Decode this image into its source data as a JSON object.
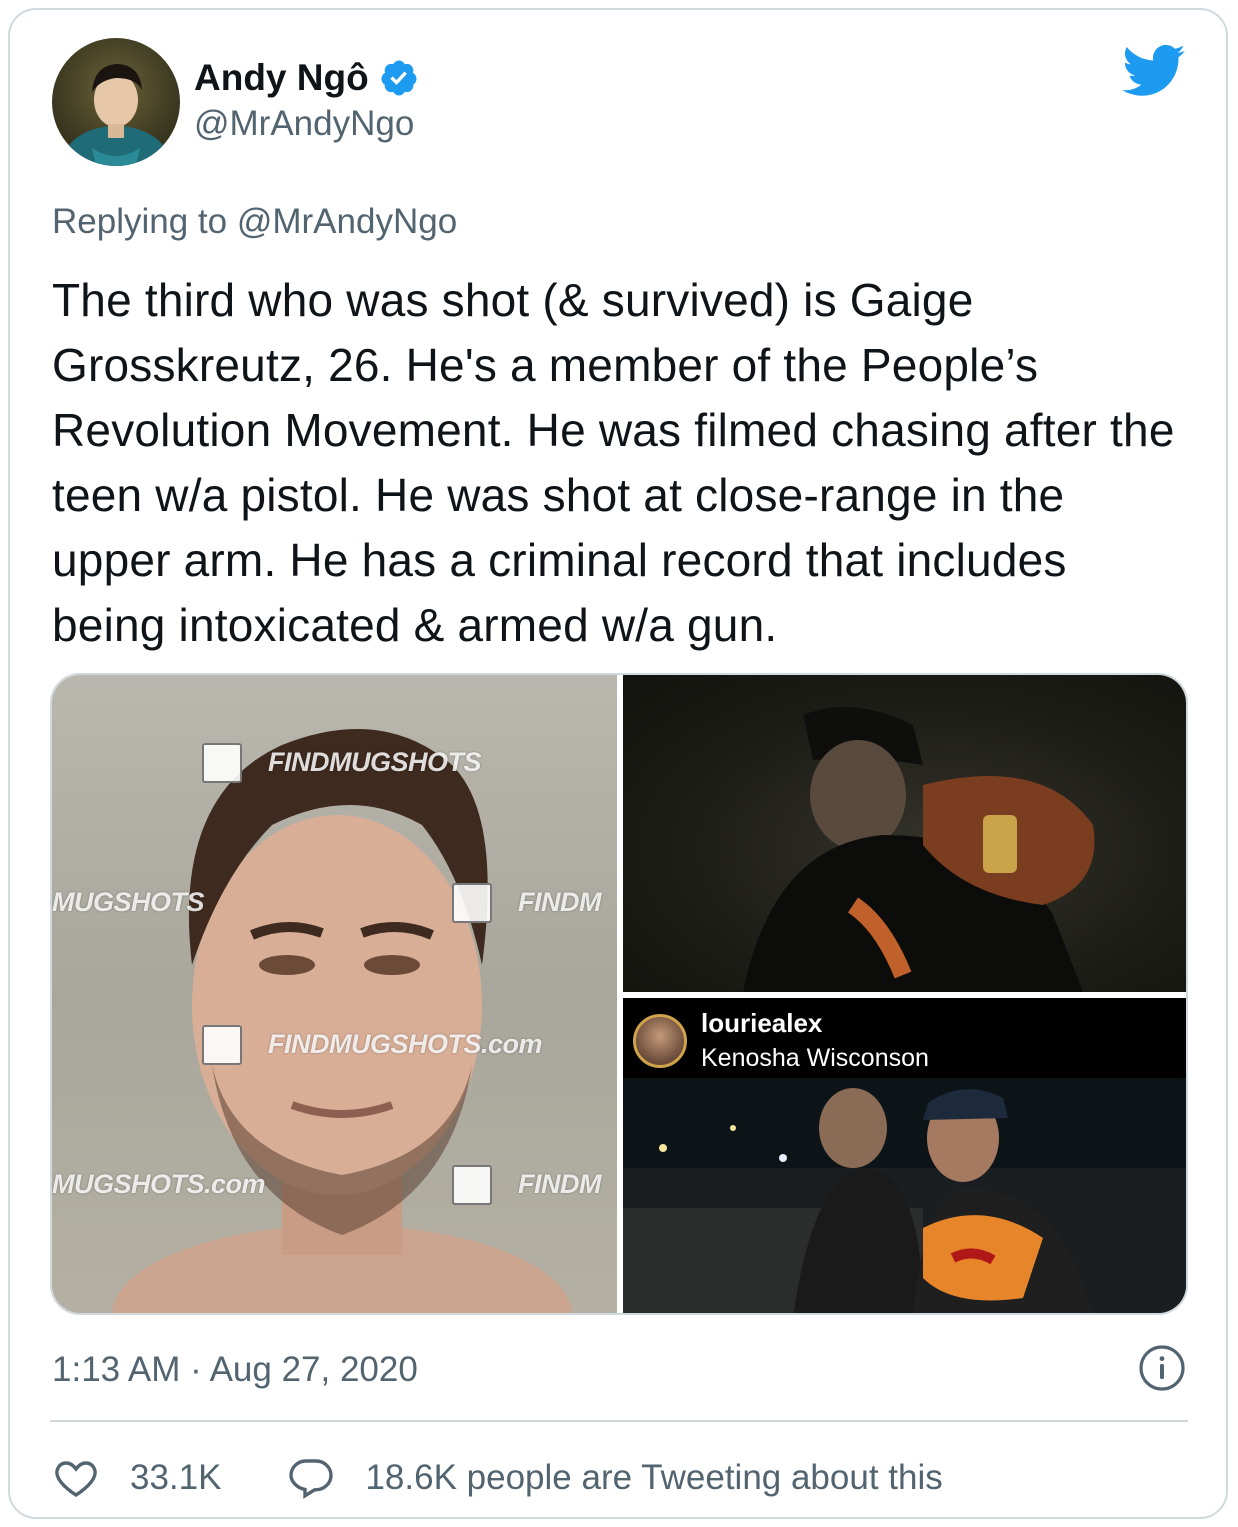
{
  "author": {
    "display_name": "Andy Ngô",
    "handle": "@MrAndyNgo",
    "verified_icon": "verified-badge-icon"
  },
  "replying": {
    "prefix": "Replying to",
    "mention": "@MrAndyNgo"
  },
  "tweet_text": "The third who was shot (& survived) is Gaige Grosskreutz, 26. He's a member of the People’s Revolution Movement. He was filmed chasing after the teen w/a pistol. He was shot at close-range in the upper arm. He has a criminal record that includes being intoxicated & armed w/a gun.",
  "media": {
    "watermarks": {
      "wm1": "FINDMUGSHOTS",
      "wm2": "MUGSHOTS",
      "wm3": "FINDM",
      "wm4": "FINDMUGSHOTS.com",
      "wm5": "MUGSHOTS.com",
      "wm6": "FINDM"
    },
    "instagram": {
      "username": "louriealex",
      "location": "Kenosha Wisconson"
    }
  },
  "timestamp": "1:13 AM · Aug 27, 2020",
  "actions": {
    "likes": "33.1K",
    "discussion": "18.6K people are Tweeting about this"
  },
  "colors": {
    "twitter_blue": "#1d9bf0",
    "secondary_text": "#536471",
    "border": "#cfd9de"
  }
}
